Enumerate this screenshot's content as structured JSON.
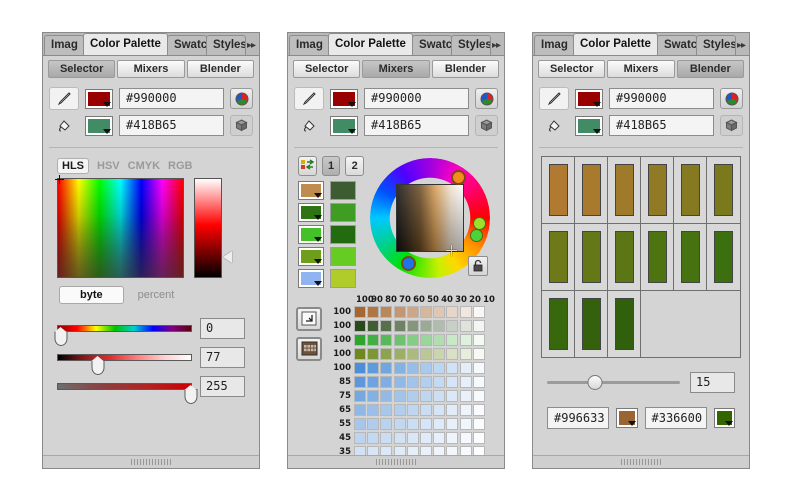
{
  "tabs": {
    "items": [
      {
        "label": "Imag",
        "active": false
      },
      {
        "label": "Color Palette",
        "active": true
      },
      {
        "label": "Swatc",
        "active": false
      },
      {
        "label": "Styles",
        "active": false
      }
    ],
    "overflow": "▸▸"
  },
  "subtabs": [
    {
      "label": "Selector"
    },
    {
      "label": "Mixers"
    },
    {
      "label": "Blender"
    }
  ],
  "colors": {
    "foreground_hex": "#990000",
    "background_hex": "#418B65",
    "foreground_swatch": "#990000",
    "background_swatch": "#418B65"
  },
  "icons": {
    "pen": "pen-icon",
    "bucket": "bucket-icon",
    "color_sphere": "color-sphere-icon",
    "cube": "cube-icon",
    "lock": "lock-open-icon",
    "swap": "swap-icon",
    "grid": "grid-icon"
  },
  "selector": {
    "modes": [
      {
        "label": "HLS",
        "active": true
      },
      {
        "label": "HSV",
        "active": false
      },
      {
        "label": "CMYK",
        "active": false
      },
      {
        "label": "RGB",
        "active": false
      }
    ],
    "units": [
      {
        "label": "byte",
        "active": true
      },
      {
        "label": "percent",
        "active": false
      }
    ],
    "lightness_marker_pct": 78,
    "sliders": [
      {
        "name": "hue",
        "value": "0",
        "pos_pct": 2
      },
      {
        "name": "lightness",
        "value": "77",
        "pos_pct": 30
      },
      {
        "name": "saturation",
        "value": "255",
        "pos_pct": 100
      }
    ]
  },
  "mixers": {
    "numbered_tabs": [
      {
        "label": "1",
        "active": true
      },
      {
        "label": "2",
        "active": false
      }
    ],
    "source_swatches": [
      "#C08B4E",
      "#2E7314",
      "#44C028",
      "#6E9E1A",
      "#8FB4F0"
    ],
    "result_swatches": [
      "#3D5C32",
      "#3E9D22",
      "#236B10",
      "#66CC22",
      "#AFCC2A"
    ],
    "wheel_markers": [
      {
        "name": "orange-marker",
        "color": "#F28C1E",
        "angle_deg": 35,
        "size": 15
      },
      {
        "name": "green-marker-1",
        "color": "#9BE02A",
        "angle_deg": 96,
        "size": 13
      },
      {
        "name": "green-marker-2",
        "color": "#4ED23C",
        "angle_deg": 110,
        "size": 13
      },
      {
        "name": "blue-marker",
        "color": "#1E74E8",
        "angle_deg": 205,
        "size": 15
      }
    ],
    "grid": {
      "column_headers": [
        "100",
        "90",
        "80",
        "70",
        "60",
        "50",
        "40",
        "30",
        "20",
        "10"
      ],
      "row_labels": [
        "100",
        "100",
        "100",
        "100",
        "100",
        "85",
        "75",
        "65",
        "55",
        "45",
        "35"
      ],
      "row_base_colors": [
        "#A5672F",
        "#2A4A1C",
        "#2BA62B",
        "#6E8A1E",
        "#4A8FD8",
        "#5E98DC",
        "#76A8E0",
        "#8FB8E6",
        "#A6C6EB",
        "#BCD4F0",
        "#D2E2F5"
      ]
    }
  },
  "blender": {
    "swatch_rows": [
      [
        "#B07A33",
        "#A87A2E",
        "#9E7A2A",
        "#917A25",
        "#857A21",
        "#7A7A1D"
      ],
      [
        "#6E7A1A",
        "#657818",
        "#5C7615",
        "#4E7412",
        "#467210",
        "#3C700E"
      ],
      [
        "#38680D",
        "#34620C",
        "#30600B"
      ]
    ],
    "slider_value": "15",
    "slider_pos_pct": 36,
    "start_hex": "#996633",
    "end_hex": "#336600",
    "start_swatch": "#996633",
    "end_swatch": "#336600"
  }
}
